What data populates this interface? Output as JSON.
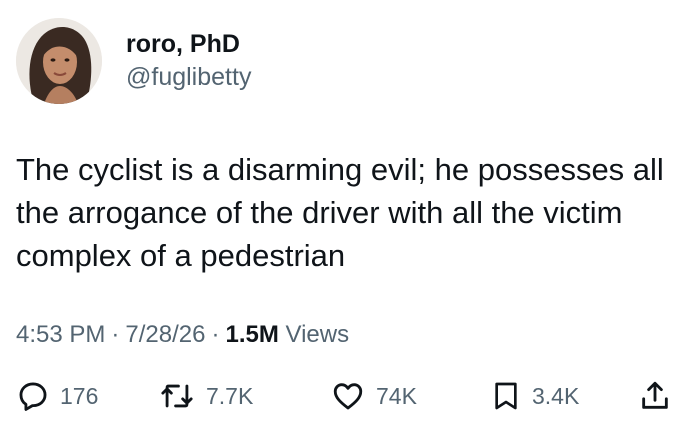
{
  "user": {
    "display_name": "roro, PhD",
    "handle": "@fuglibetty"
  },
  "tweet": {
    "text": "The cyclist is a disarming evil; he possesses all the arrogance of the driver with all the victim complex of a pedestrian",
    "time": "4:53 PM",
    "date": "7/28/26",
    "views_count": "1.5M",
    "views_label": "Views"
  },
  "actions": {
    "replies": "176",
    "reposts": "7.7K",
    "likes": "74K",
    "bookmarks": "3.4K"
  },
  "icons": [
    "reply-icon",
    "repost-icon",
    "like-icon",
    "bookmark-icon",
    "share-icon"
  ],
  "colors": {
    "text": "#0f1419",
    "secondary": "#536471"
  }
}
